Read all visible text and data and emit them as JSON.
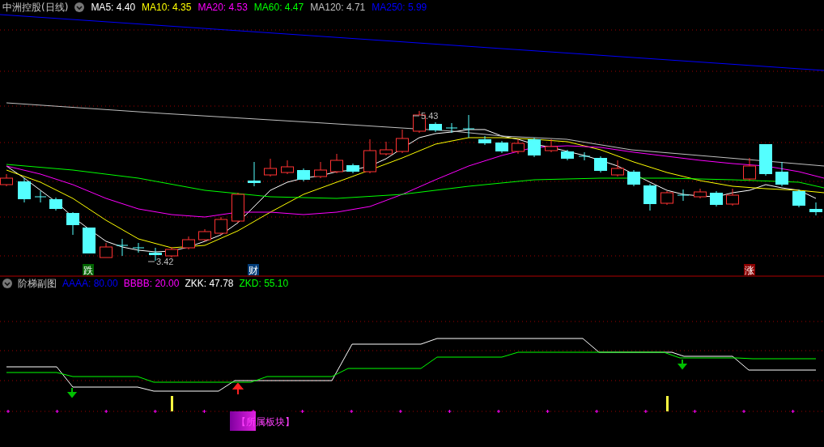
{
  "main_chart": {
    "title": "中洲控股(日线)",
    "indicators": [
      {
        "label": "MA5:",
        "value": "4.40",
        "color": "#ffffff"
      },
      {
        "label": "MA10:",
        "value": "4.35",
        "color": "#ffff00"
      },
      {
        "label": "MA20:",
        "value": "4.53",
        "color": "#ff00ff"
      },
      {
        "label": "MA60:",
        "value": "4.47",
        "color": "#00ff00"
      },
      {
        "label": "MA120:",
        "value": "4.71",
        "color": "#c0c0c0"
      },
      {
        "label": "MA250:",
        "value": "5.99",
        "color": "#0000ff"
      }
    ],
    "price_labels": [
      {
        "text": "5.43"
      },
      {
        "text": "3.42"
      }
    ],
    "event_tags": [
      {
        "text": "跌",
        "color": "#006400"
      },
      {
        "text": "财",
        "color": "#003c78"
      },
      {
        "text": "涨",
        "color": "#8b0000"
      }
    ]
  },
  "sub_chart": {
    "title": "阶梯副图",
    "indicators": [
      {
        "label": "AAAA:",
        "value": "80.00",
        "color": "#0000ff"
      },
      {
        "label": "BBBB:",
        "value": "20.00",
        "color": "#ff00ff"
      },
      {
        "label": "ZKK:",
        "value": "47.78",
        "color": "#ffffff"
      },
      {
        "label": "ZKD:",
        "value": "55.10",
        "color": "#00ff00"
      }
    ],
    "sector_button": "【所属板块】"
  }
}
